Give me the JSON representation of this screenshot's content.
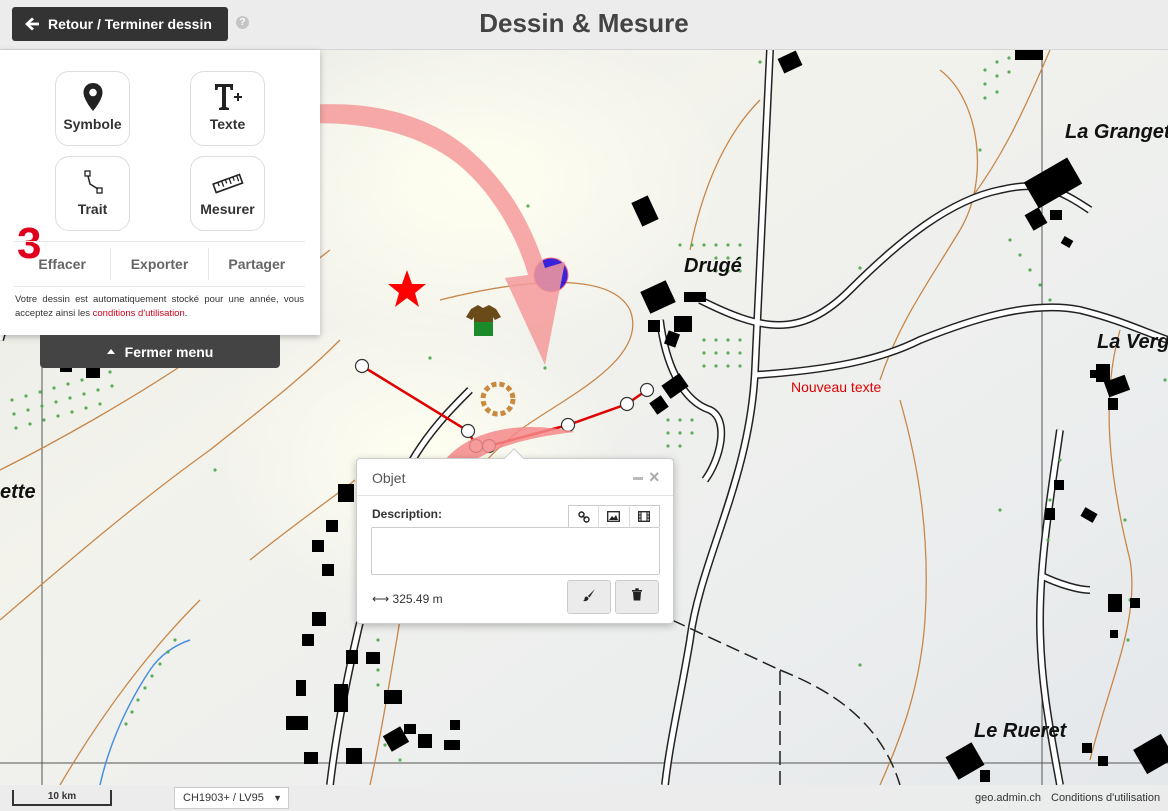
{
  "header": {
    "back_button_label": "Retour / Terminer dessin",
    "help_icon_text": "?",
    "title": "Dessin & Mesure"
  },
  "panel": {
    "tools": [
      {
        "label": "Symbole",
        "icon": "map-marker-icon"
      },
      {
        "label": "Texte",
        "icon": "text-plus-icon"
      },
      {
        "label": "Trait",
        "icon": "polyline-icon"
      },
      {
        "label": "Mesurer",
        "icon": "ruler-icon"
      }
    ],
    "step_number": "3",
    "actions": {
      "delete": "Effacer",
      "export": "Exporter",
      "share": "Partager"
    },
    "notice_text": "Votre dessin est automatiquement stocké pour une année, vous acceptez ainsi les ",
    "notice_link": "conditions d'utilisation",
    "notice_end": ".",
    "close_menu_label": "Fermer menu"
  },
  "map": {
    "place_labels": [
      "La Grangett",
      "Drugé",
      "La Vergi",
      "ette",
      "Le Rueret"
    ],
    "drawn_text": "Nouveau texte",
    "symbol_colors": {
      "star": "#ff0000",
      "circle": "#0000ff",
      "line": "#e00000"
    }
  },
  "popup": {
    "title": "Objet",
    "minimize_symbol": "–",
    "close_symbol": "×",
    "description_label": "Description:",
    "media_buttons": [
      "link-icon",
      "image-icon",
      "film-icon"
    ],
    "measurement": "325.49 m",
    "buttons": [
      "brush-icon",
      "trash-icon"
    ]
  },
  "footer": {
    "scale_label": "10 km",
    "crs_select": "CH1903+ / LV95",
    "domain": "geo.admin.ch",
    "terms": "Conditions d'utilisation"
  }
}
